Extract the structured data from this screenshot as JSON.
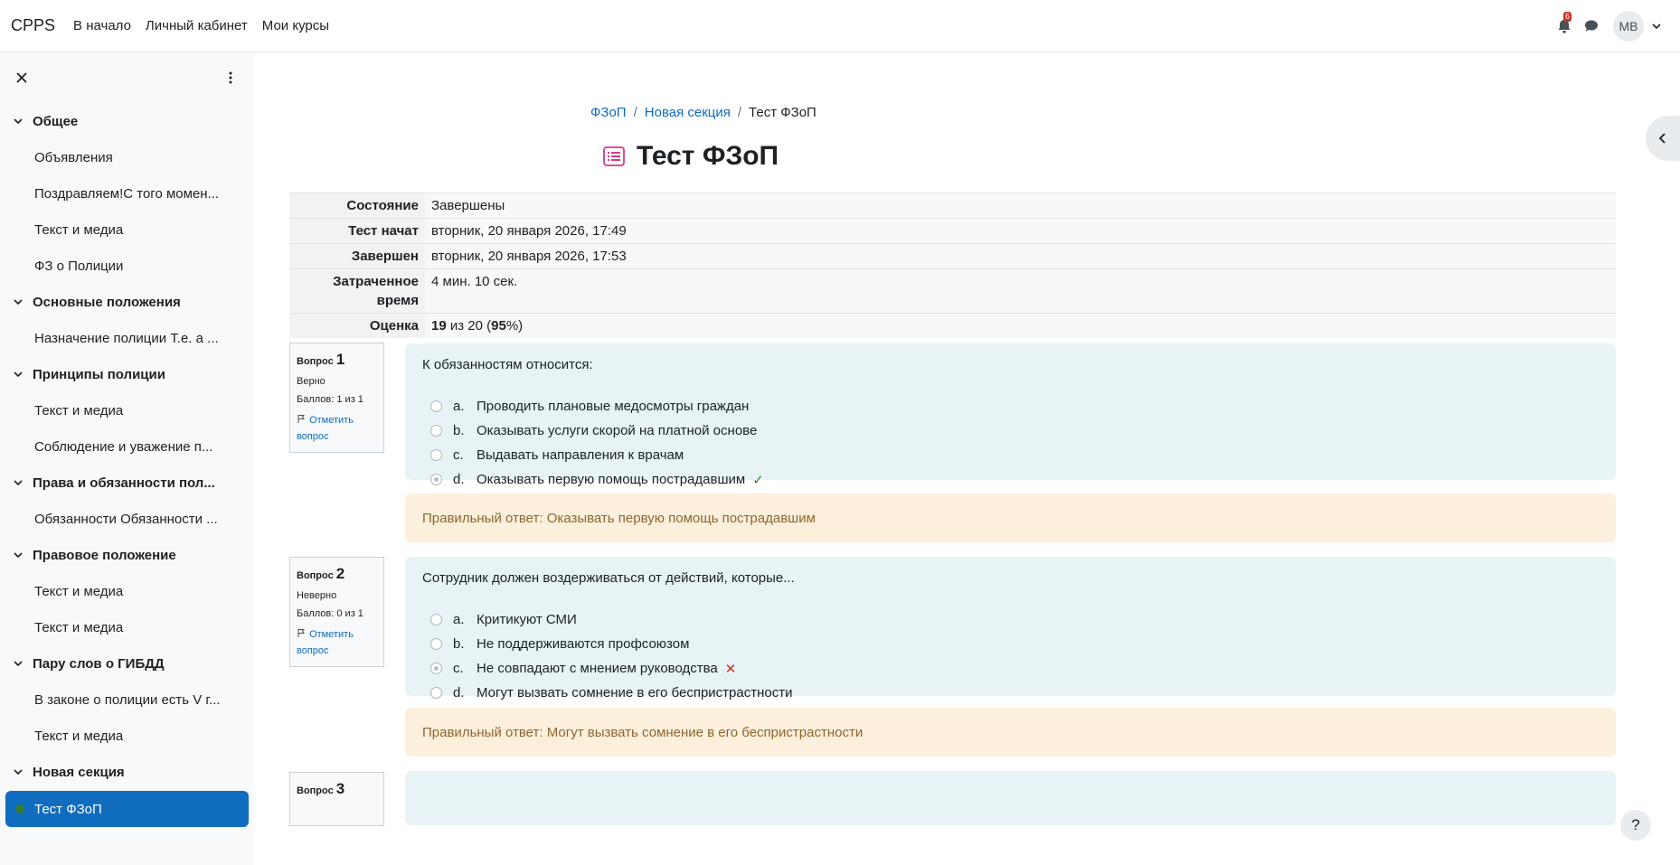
{
  "navbar": {
    "brand": "CPPS",
    "links": [
      "В начало",
      "Личный кабинет",
      "Мои курсы"
    ],
    "notifications_count": "6",
    "avatar_initials": "MB"
  },
  "drawer": {
    "items": [
      {
        "type": "section",
        "label": "Общее"
      },
      {
        "type": "activity",
        "label": "Объявления"
      },
      {
        "type": "activity",
        "label": "Поздравляем!С того момен..."
      },
      {
        "type": "activity",
        "label": "Текст и медиа"
      },
      {
        "type": "activity",
        "label": "ФЗ о Полиции"
      },
      {
        "type": "section",
        "label": "Основные положения"
      },
      {
        "type": "activity",
        "label": "Назначение полиции Т.е. а ..."
      },
      {
        "type": "section",
        "label": "Принципы полиции"
      },
      {
        "type": "activity",
        "label": "Текст и медиа"
      },
      {
        "type": "activity",
        "label": "Соблюдение и уважение п..."
      },
      {
        "type": "section",
        "label": "Права и обязанности пол..."
      },
      {
        "type": "activity",
        "label": "Обязанности Обязанности ..."
      },
      {
        "type": "section",
        "label": "Правовое положение"
      },
      {
        "type": "activity",
        "label": "Текст и медиа"
      },
      {
        "type": "activity",
        "label": "Текст и медиа"
      },
      {
        "type": "section",
        "label": "Пару слов о ГИБДД"
      },
      {
        "type": "activity",
        "label": "В законе о полиции есть V г..."
      },
      {
        "type": "activity",
        "label": "Текст и медиа"
      },
      {
        "type": "section",
        "label": "Новая секция"
      },
      {
        "type": "activity",
        "label": "Тест ФЗоП",
        "active": true
      }
    ]
  },
  "breadcrumb": {
    "items": [
      "ФЗоП",
      "Новая секция",
      "Тест ФЗоП"
    ]
  },
  "page": {
    "title": "Тест ФЗоП"
  },
  "summary": {
    "state_label": "Состояние",
    "state_value": "Завершены",
    "started_label": "Тест начат",
    "started_value": "вторник, 20 января 2026, 17:49",
    "finished_label": "Завершен",
    "finished_value": "вторник, 20 января 2026, 17:53",
    "time_label": "Затраченное время",
    "time_value": "4 мин. 10 сек.",
    "grade_label": "Оценка",
    "grade_score": "19",
    "grade_of": " из 20 (",
    "grade_percent": "95",
    "grade_close": "%)"
  },
  "questions": [
    {
      "label": "Вопрос",
      "number": "1",
      "state": "Верно",
      "marks": "Баллов: 1 из 1",
      "flag": "Отметить вопрос",
      "text": "К обязанностям относится:",
      "answers": [
        {
          "letter": "a.",
          "text": "Проводить плановые медосмотры граждан"
        },
        {
          "letter": "b.",
          "text": "Оказывать услуги скорой на платной основе"
        },
        {
          "letter": "c.",
          "text": "Выдавать направления к врачам"
        },
        {
          "letter": "d.",
          "text": "Оказывать первую помощь пострадавшим",
          "selected": true,
          "mark": "✓"
        }
      ],
      "feedback": "Правильный ответ: Оказывать первую помощь пострадавшим"
    },
    {
      "label": "Вопрос",
      "number": "2",
      "state": "Неверно",
      "marks": "Баллов: 0 из 1",
      "flag": "Отметить вопрос",
      "text": "Сотрудник должен воздерживаться от действий, которые...",
      "answers": [
        {
          "letter": "a.",
          "text": "Критикуют СМИ"
        },
        {
          "letter": "b.",
          "text": "Не поддерживаются профсоюзом"
        },
        {
          "letter": "c.",
          "text": "Не совпадают с мнением руководства",
          "selected": true,
          "mark": "✕"
        },
        {
          "letter": "d.",
          "text": "Могут вызвать сомнение в его беспристрастности"
        }
      ],
      "feedback": "Правильный ответ: Могут вызвать сомнение в его беспристрастности"
    },
    {
      "label": "Вопрос",
      "number": "3"
    }
  ],
  "help_label": "?"
}
